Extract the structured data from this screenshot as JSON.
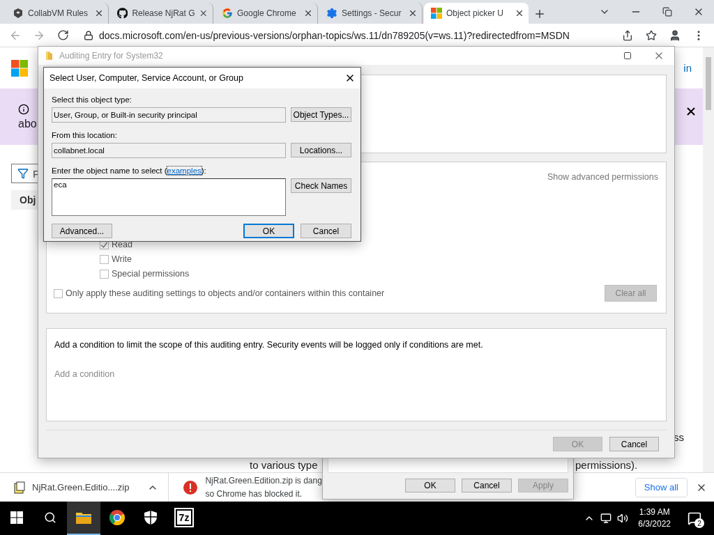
{
  "browser": {
    "tabs": [
      {
        "title": "CollabVM Rules",
        "selected": false
      },
      {
        "title": "Release NjRat G",
        "selected": false
      },
      {
        "title": "Google Chrome",
        "selected": false
      },
      {
        "title": "Settings - Secur",
        "selected": false
      },
      {
        "title": "Object picker U",
        "selected": true
      }
    ],
    "url": "docs.microsoft.com/en-us/previous-versions/orphan-topics/ws.11/dn789205(v=ws.11)?redirectedfrom=MSDN"
  },
  "page": {
    "sign_in_fragment": "in",
    "banner_text": "abo",
    "filter_fragment": "F",
    "tab_fragment": "Obj",
    "fragments": [
      "ss",
      "to various type",
      "permissions)."
    ]
  },
  "auditing_window": {
    "title": "Auditing Entry for System32",
    "show_advanced": "Show advanced permissions",
    "permissions": [
      {
        "label": "Read",
        "checked": true
      },
      {
        "label": "Write",
        "checked": false
      },
      {
        "label": "Special permissions",
        "checked": false
      }
    ],
    "scope_option": {
      "label": "Only apply these auditing settings to objects and/or containers within this container",
      "checked": false
    },
    "clear_all": {
      "label": "Clear all",
      "disabled": true
    },
    "condition_text": "Add a condition to limit the scope of this auditing entry. Security events will be logged only if conditions are met.",
    "add_condition": "Add a condition",
    "buttons": [
      {
        "label": "OK",
        "disabled": true
      },
      {
        "label": "Cancel",
        "disabled": false
      }
    ]
  },
  "properties_dialog": {
    "buttons": [
      {
        "label": "OK",
        "disabled": false
      },
      {
        "label": "Cancel",
        "disabled": false
      },
      {
        "label": "Apply",
        "disabled": true
      }
    ]
  },
  "select_dialog": {
    "title": "Select User, Computer, Service Account, or Group",
    "object_type_label": "Select this object type:",
    "object_type": "User, Group, or Built-in security principal",
    "object_types_button": "Object Types...",
    "location_label": "From this location:",
    "location": "collabnet.local",
    "locations_button": "Locations...",
    "name_label_before": "Enter the object name to select (",
    "name_label_link": "examples",
    "name_label_after": "):",
    "name_value": "eca",
    "check_names_button": "Check Names",
    "advanced_button": "Advanced...",
    "ok_button": "OK",
    "cancel_button": "Cancel"
  },
  "downloads": {
    "items": [
      {
        "kind": "file",
        "name": "NjRat.Green.Editio....zip"
      },
      {
        "kind": "blocked",
        "lines": [
          "NjRat.Green.Edition.zip is dang",
          "so Chrome has blocked it."
        ]
      }
    ],
    "show_all": "Show all"
  },
  "taskbar": {
    "apps": [
      {
        "kind": "folder",
        "selected": true
      },
      {
        "kind": "chrome",
        "selected": false
      },
      {
        "kind": "shield",
        "selected": false
      },
      {
        "kind": "archiver",
        "text": "7z",
        "selected": false
      }
    ],
    "time": "1:39 AM",
    "date": "6/3/2022",
    "notifications": "2"
  }
}
